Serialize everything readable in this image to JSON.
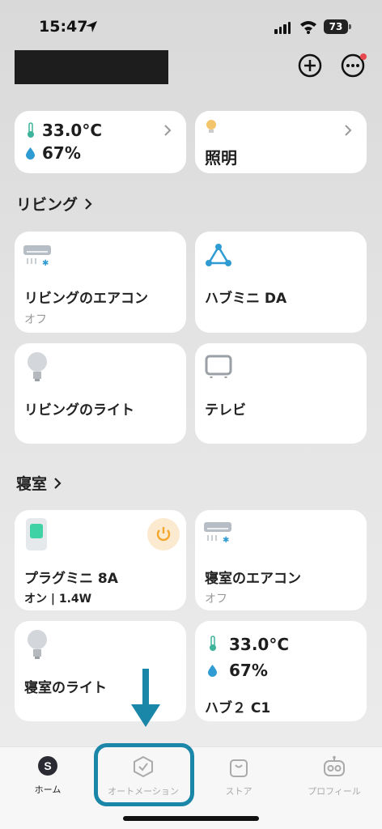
{
  "status_bar": {
    "time": "15:47",
    "battery": "73"
  },
  "climate_card": {
    "temperature": "33.0°C",
    "humidity": "67%"
  },
  "lighting_card": {
    "label": "照明"
  },
  "sections": {
    "living": {
      "title": "リビング"
    },
    "bedroom": {
      "title": "寝室"
    }
  },
  "devices": {
    "living_aircon": {
      "name": "リビングのエアコン",
      "status": "オフ"
    },
    "hub_mini": {
      "name": "ハブミニ DA"
    },
    "living_light": {
      "name": "リビングのライト"
    },
    "tv": {
      "name": "テレビ"
    },
    "plug_mini": {
      "name": "プラグミニ 8A",
      "status": "オン | 1.4W"
    },
    "bedroom_aircon": {
      "name": "寝室のエアコン",
      "status": "オフ"
    },
    "bedroom_light": {
      "name": "寝室のライト"
    },
    "hub2": {
      "name": "ハブ２ C1",
      "temperature": "33.0°C",
      "humidity": "67%"
    }
  },
  "tabbar": {
    "home": "ホーム",
    "automation": "オートメーション",
    "store": "ストア",
    "profile": "プロフィール",
    "home_icon_letter": "S"
  },
  "colors": {
    "accent": "#1a86a8",
    "tab_active": "#222222",
    "tab_inactive": "#aaaaaa"
  }
}
